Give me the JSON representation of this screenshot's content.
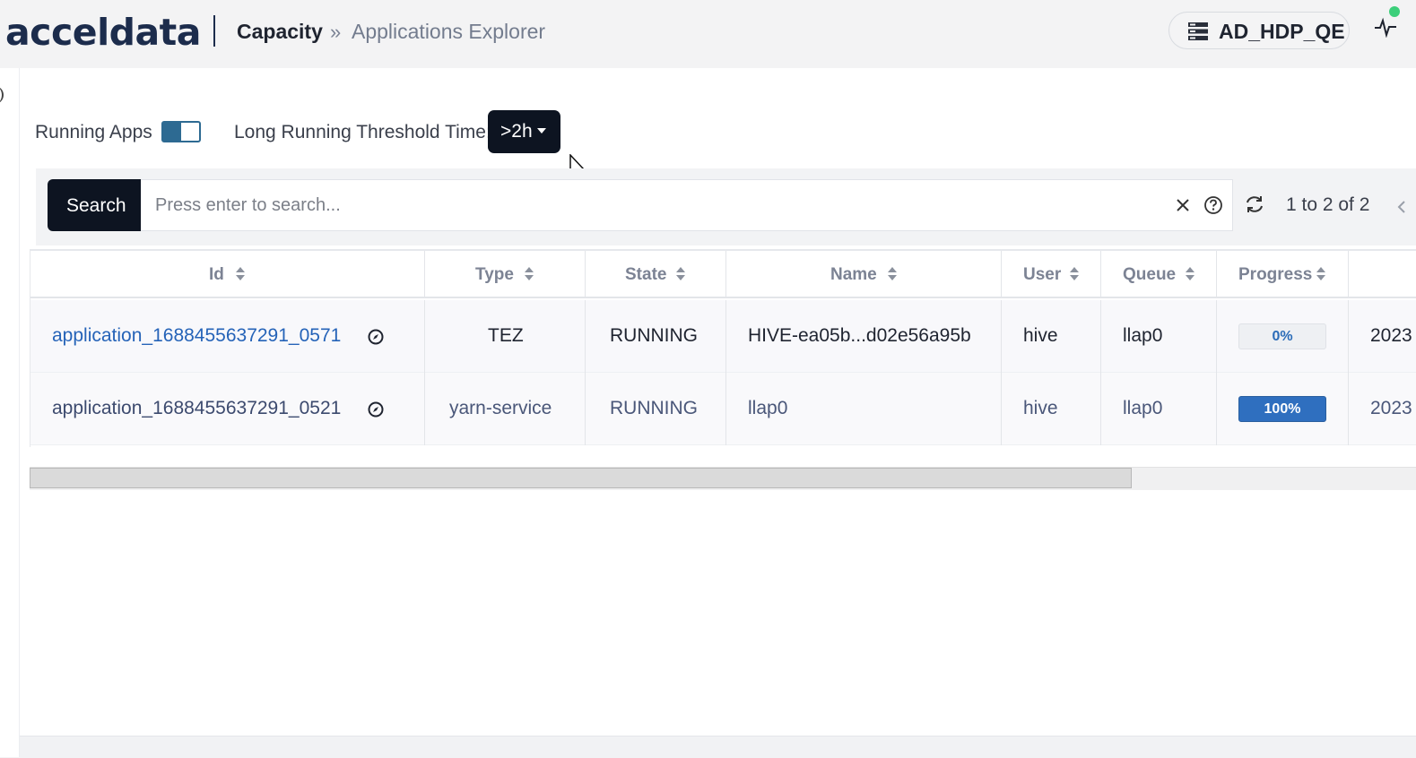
{
  "header": {
    "logo_text": "acceldata",
    "breadcrumb_parent": "Capacity",
    "breadcrumb_separator": "»",
    "breadcrumb_current": "Applications Explorer",
    "cluster_name": "AD_HDP_QE",
    "cluster_icon": "server-icon",
    "status_icon": "pulse-icon",
    "status_color": "#3ccf7a"
  },
  "filters": {
    "running_apps_label": "Running Apps",
    "running_apps_enabled": true,
    "threshold_label": "Long Running Threshold Time:",
    "threshold_value": ">2h"
  },
  "search": {
    "button_label": "Search",
    "placeholder": "Press enter to search...",
    "value": "",
    "page_info": "1 to 2 of 2"
  },
  "table": {
    "columns": [
      "Id",
      "Type",
      "State",
      "Name",
      "User",
      "Queue",
      "Progress"
    ],
    "rows": [
      {
        "id": "application_1688455637291_0571",
        "type": "TEZ",
        "state": "RUNNING",
        "name": "HIVE-ea05b...d02e56a95b",
        "user": "hive",
        "queue": "llap0",
        "progress_label": "0%",
        "progress": 0,
        "start": "2023"
      },
      {
        "id": "application_1688455637291_0521",
        "type": "yarn-service",
        "state": "RUNNING",
        "name": "llap0",
        "user": "hive",
        "queue": "llap0",
        "progress_label": "100%",
        "progress": 100,
        "start": "2023"
      }
    ]
  },
  "colors": {
    "accent_dark": "#0d1421",
    "link_blue": "#2563b8",
    "progress_blue": "#2f6fbf"
  }
}
